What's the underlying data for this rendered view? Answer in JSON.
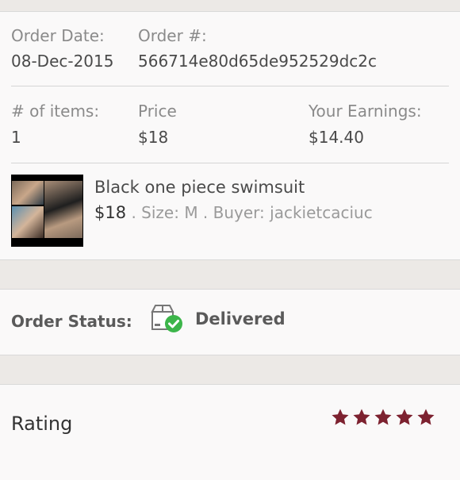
{
  "order": {
    "date_label": "Order Date:",
    "date_value": "08-Dec-2015",
    "number_label": "Order #:",
    "number_value": "566714e80d65de952529dc2c",
    "items_label": "# of items:",
    "items_value": "1",
    "price_label": "Price",
    "price_value": "$18",
    "earnings_label": "Your Earnings:",
    "earnings_value": "$14.40"
  },
  "item": {
    "title": "Black one piece swimsuit",
    "price": "$18",
    "details": " . Size: M . Buyer: jackietcaciuc"
  },
  "status": {
    "label": "Order Status:",
    "value": "Delivered",
    "icon": "package-delivered-icon",
    "check_color": "#3cb54a"
  },
  "rating": {
    "label": "Rating",
    "stars": 5,
    "max_stars": 5,
    "star_color": "#7d2230"
  }
}
